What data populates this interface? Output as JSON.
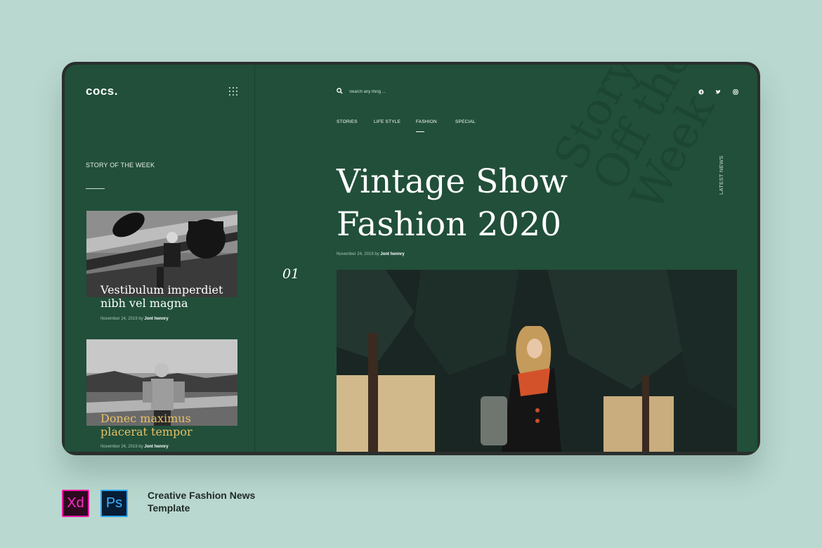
{
  "app": {
    "logo": "cocs."
  },
  "sidebar": {
    "section_title": "STORY OF THE WEEK",
    "cards": [
      {
        "title": "Vestibulum imperdiet nibh vel magna",
        "date": "November 24, 2019 by ",
        "author": "Jont hennry"
      },
      {
        "title": "Donec maximus placerat tempor",
        "date": "November 24, 2019 by ",
        "author": "Jont hennry"
      }
    ]
  },
  "search": {
    "placeholder": "Search any thing ..."
  },
  "nav": {
    "items": [
      "STORIES",
      "LIFE STYLE",
      "FASHION",
      "SPECIAL"
    ],
    "active": "FASHION"
  },
  "hero": {
    "slide_number": "01",
    "title_line1": "Vintage Show",
    "title_line2": "Fashion 2020",
    "date": "November 24, 2019 by ",
    "author": "Jont hennry",
    "watermark": "Story\nOff the\nWeek",
    "side_label": "LATEST NEWS"
  },
  "social": [
    "facebook-icon",
    "twitter-icon",
    "instagram-icon"
  ],
  "colors": {
    "background": "#b9d8cf",
    "panel": "#214f3a",
    "accent_gold": "#e7c167"
  },
  "footer": {
    "xd_label": "Xd",
    "ps_label": "Ps",
    "caption": "Creative Fashion News Template"
  }
}
